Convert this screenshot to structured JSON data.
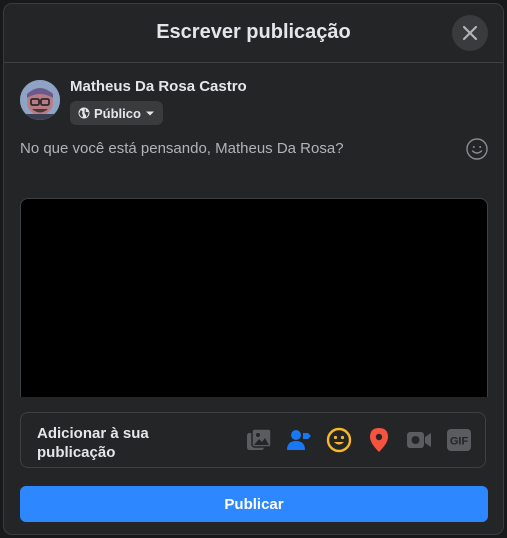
{
  "dialog": {
    "title": "Escrever publicação",
    "close_icon": "close-icon"
  },
  "user": {
    "name": "Matheus Da Rosa Castro",
    "avatar_icon": "avatar",
    "privacy": {
      "label": "Público",
      "icon": "globe-icon",
      "dropdown_icon": "caret-down-icon"
    }
  },
  "composer": {
    "placeholder": "No que você está pensando, Matheus Da Rosa?",
    "emoji_icon": "smiley-icon"
  },
  "add_to_post": {
    "label": "Adicionar à sua publicação",
    "tools": [
      {
        "name": "photo-video",
        "icon": "photo-icon",
        "color": "#5a5c60"
      },
      {
        "name": "tag-people",
        "icon": "tag-people-icon",
        "color": "#1877f2"
      },
      {
        "name": "feeling-activity",
        "icon": "feeling-icon",
        "color": "#f7b928"
      },
      {
        "name": "check-in",
        "icon": "location-icon",
        "color": "#f5533d"
      },
      {
        "name": "live-video",
        "icon": "video-icon",
        "color": "#5a5c60"
      },
      {
        "name": "gif",
        "icon": "gif-icon",
        "color": "#5a5c60"
      }
    ]
  },
  "publish_button": {
    "label": "Publicar",
    "color": "#2d88ff"
  }
}
